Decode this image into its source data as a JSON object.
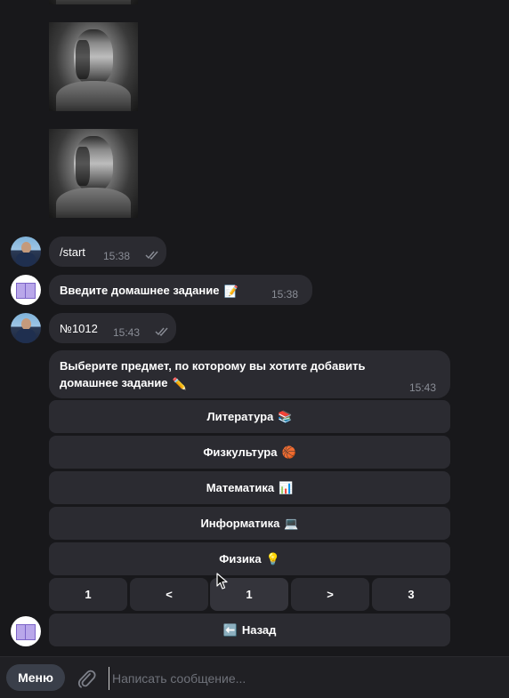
{
  "messages": {
    "start": {
      "text": "/start",
      "time": "15:38"
    },
    "prompt": {
      "text": "Введите домашнее задание",
      "emoji": "📝",
      "time": "15:38"
    },
    "number": {
      "text": "№1012",
      "time": "15:43"
    },
    "choose": {
      "line1": "Выберите предмет, по которому вы хотите добавить",
      "line2": "домашнее задание",
      "emoji": "✏️",
      "time": "15:43"
    }
  },
  "keyboard": {
    "subjects": [
      {
        "label": "Литература",
        "emoji": "📚"
      },
      {
        "label": "Физкультура",
        "emoji": "🏀"
      },
      {
        "label": "Математика",
        "emoji": "📊"
      },
      {
        "label": "Информатика",
        "emoji": "💻"
      },
      {
        "label": "Физика",
        "emoji": "💡"
      }
    ],
    "pager": [
      "1",
      "<",
      "1",
      ">",
      "3"
    ],
    "back": {
      "emoji": "⬅️",
      "label": "Назад"
    }
  },
  "composer": {
    "menu_label": "Меню",
    "placeholder": "Написать сообщение..."
  },
  "colors": {
    "background": "#18181b",
    "bubble": "#2b2b31",
    "time": "#8a8d96",
    "menu_button": "#3a3f4a"
  }
}
